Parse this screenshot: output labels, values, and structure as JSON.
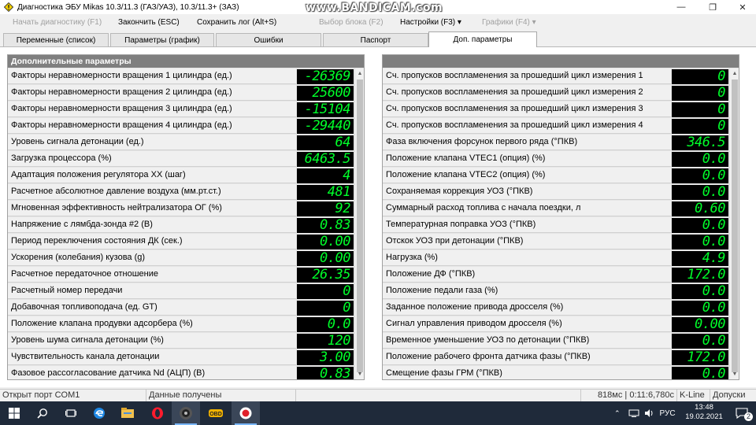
{
  "window": {
    "title": "Диагностика ЭБУ Mikas 10.3/11.3 (ГАЗ/УАЗ), 10.3/11.3+ (ЗАЗ)",
    "watermark": "www.BANDICAM.com",
    "minimize": "—",
    "restore": "❐",
    "close": "✕"
  },
  "menu": {
    "start_diag": "Начать диагностику (F1)",
    "finish": "Закончить (ESC)",
    "save_log": "Сохранить лог (Alt+S)",
    "select_block": "Выбор блока (F2)",
    "settings": "Настройки (F3) ▾",
    "graphs": "Графики (F4) ▾"
  },
  "tabs": [
    {
      "label": "Переменные (список)"
    },
    {
      "label": "Параметры (график)"
    },
    {
      "label": "Ошибки"
    },
    {
      "label": "Паспорт"
    },
    {
      "label": "Доп. параметры"
    }
  ],
  "left_panel": {
    "header": "Дополнительные параметры",
    "rows": [
      {
        "label": "Факторы неравномерности вращения 1 цилиндра (ед.)",
        "value": "-26369"
      },
      {
        "label": "Факторы неравномерности вращения 2 цилиндра (ед.)",
        "value": "25600"
      },
      {
        "label": "Факторы неравномерности вращения 3 цилиндра (ед.)",
        "value": "-15104"
      },
      {
        "label": "Факторы неравномерности вращения 4 цилиндра (ед.)",
        "value": "-29440"
      },
      {
        "label": "Уровень сигнала детонации (ед.)",
        "value": "64"
      },
      {
        "label": "Загрузка процессора (%)",
        "value": "6463.5"
      },
      {
        "label": "Адаптация положения регулятора ХХ (шаг)",
        "value": "4"
      },
      {
        "label": "Расчетное абсолютное давление воздуха (мм.рт.ст.)",
        "value": "481"
      },
      {
        "label": "Мгновенная эффективность нейтрализатора ОГ (%)",
        "value": "92"
      },
      {
        "label": "Напряжение с лямбда-зонда #2 (В)",
        "value": "0.83"
      },
      {
        "label": "Период переключения состояния ДК (сек.)",
        "value": "0.00"
      },
      {
        "label": "Ускорения (колебания) кузова (g)",
        "value": "0.00"
      },
      {
        "label": "Расчетное передаточное отношение",
        "value": "26.35"
      },
      {
        "label": "Расчетный номер передачи",
        "value": "0"
      },
      {
        "label": "Добавочная топливоподача (ед. GT)",
        "value": "0"
      },
      {
        "label": "Положение клапана продувки адсорбера (%)",
        "value": "0.0"
      },
      {
        "label": "Уровень шума сигнала детонации (%)",
        "value": "120"
      },
      {
        "label": "Чувствительность канала детонации",
        "value": "3.00"
      },
      {
        "label": "Фазовое рассогласование датчика Nd (АЦП) (В)",
        "value": "0.83"
      }
    ]
  },
  "right_panel": {
    "header": "",
    "rows": [
      {
        "label": "Сч. пропусков воспламенения за прошедший цикл измерения 1",
        "value": "0"
      },
      {
        "label": "Сч. пропусков воспламенения за прошедший цикл измерения 2",
        "value": "0"
      },
      {
        "label": "Сч. пропусков воспламенения за прошедший цикл измерения 3",
        "value": "0"
      },
      {
        "label": "Сч. пропусков воспламенения за прошедший цикл измерения 4",
        "value": "0"
      },
      {
        "label": "Фаза включения форсунок первого ряда (°ПКВ)",
        "value": "346.5"
      },
      {
        "label": "Положение клапана VTEC1 (опция) (%)",
        "value": "0.0"
      },
      {
        "label": "Положение клапана VTEC2 (опция) (%)",
        "value": "0.0"
      },
      {
        "label": "Сохраняемая коррекция УОЗ (°ПКВ)",
        "value": "0.0"
      },
      {
        "label": "Суммарный расход топлива с начала поездки, л",
        "value": "0.60"
      },
      {
        "label": "Температурная поправка УОЗ (°ПКВ)",
        "value": "0.0"
      },
      {
        "label": "Отскок УОЗ при детонации (°ПКВ)",
        "value": "0.0"
      },
      {
        "label": "Нагрузка (%)",
        "value": "4.9"
      },
      {
        "label": "Положение ДФ (°ПКВ)",
        "value": "172.0"
      },
      {
        "label": "Положение педали газа (%)",
        "value": "0.0"
      },
      {
        "label": "Заданное положение привода дросселя (%)",
        "value": "0.0"
      },
      {
        "label": "Сигнал управления приводом  дросселя (%)",
        "value": "0.00"
      },
      {
        "label": "Временное уменьшение УОЗ по детонации (°ПКВ)",
        "value": "0.0"
      },
      {
        "label": "Положение рабочего фронта датчика фазы (°ПКВ)",
        "value": "172.0"
      },
      {
        "label": "Смещение фазы ГРМ (°ПКВ)",
        "value": "0.0"
      }
    ]
  },
  "statusbar": {
    "port": "Открыт порт COM1",
    "data": "Данные получены",
    "timing": "818мс | 0:11:6,780с",
    "protocol": "K-Line",
    "tolerances": "Допуски"
  },
  "taskbar": {
    "lang": "РУС",
    "time": "13:48",
    "date": "19.02.2021",
    "notifications": "2",
    "icons": [
      "windows-start-icon",
      "search-icon",
      "task-view-icon",
      "edge-icon",
      "file-explorer-icon",
      "opera-icon",
      "diagnostic-app-icon",
      "car-scanner-icon",
      "bandicam-record-icon"
    ]
  },
  "colors": {
    "lcd_bg": "#000000",
    "lcd_text": "#00ff2a",
    "panel_header": "#7f7f7f",
    "taskbar": "#1f2a3a"
  }
}
